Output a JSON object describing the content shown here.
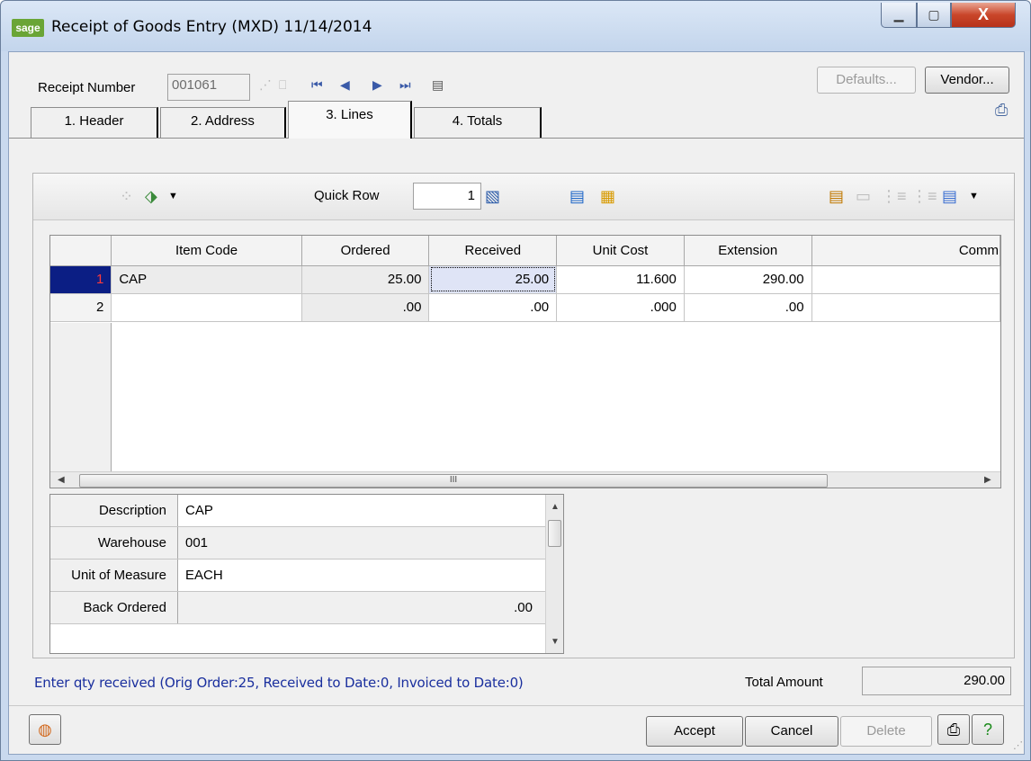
{
  "window": {
    "app_badge": "sage",
    "title": "Receipt of Goods Entry (MXD) 11/14/2014",
    "minimize": "▁",
    "maximize": "▢",
    "close": "X"
  },
  "header": {
    "receipt_number_label": "Receipt Number",
    "receipt_number_value": "001061",
    "defaults_button": "Defaults...",
    "vendor_button": "Vendor..."
  },
  "tabs": [
    {
      "label": "1. Header"
    },
    {
      "label": "2. Address"
    },
    {
      "label": "3. Lines",
      "active": true
    },
    {
      "label": "4. Totals"
    }
  ],
  "toolbar": {
    "quick_row_label": "Quick Row",
    "quick_row_value": "1"
  },
  "grid": {
    "columns": [
      "",
      "Item Code",
      "Ordered",
      "Received",
      "Unit Cost",
      "Extension",
      "Comm"
    ],
    "rows": [
      {
        "row": "1",
        "item_code": "CAP",
        "ordered": "25.00",
        "received": "25.00",
        "unit_cost": "11.600",
        "extension": "290.00",
        "comment": ""
      },
      {
        "row": "2",
        "item_code": "",
        "ordered": ".00",
        "received": ".00",
        "unit_cost": ".000",
        "extension": ".00",
        "comment": ""
      }
    ],
    "scroll_thumb": "III"
  },
  "detail": {
    "rows": [
      {
        "label": "Description",
        "value": "CAP"
      },
      {
        "label": "Warehouse",
        "value": "001"
      },
      {
        "label": "Unit of Measure",
        "value": "EACH"
      },
      {
        "label": "Back Ordered",
        "value": ".00"
      }
    ]
  },
  "status": {
    "message": "Enter qty received (Orig Order:25, Received to Date:0, Invoiced to Date:0)",
    "total_label": "Total Amount",
    "total_value": "290.00"
  },
  "buttons": {
    "accept": "Accept",
    "cancel": "Cancel",
    "delete": "Delete"
  },
  "colors": {
    "status_text": "#1a2f9e",
    "selected_row": "#0b1e84",
    "focus_cell": "#dfe4f6"
  }
}
